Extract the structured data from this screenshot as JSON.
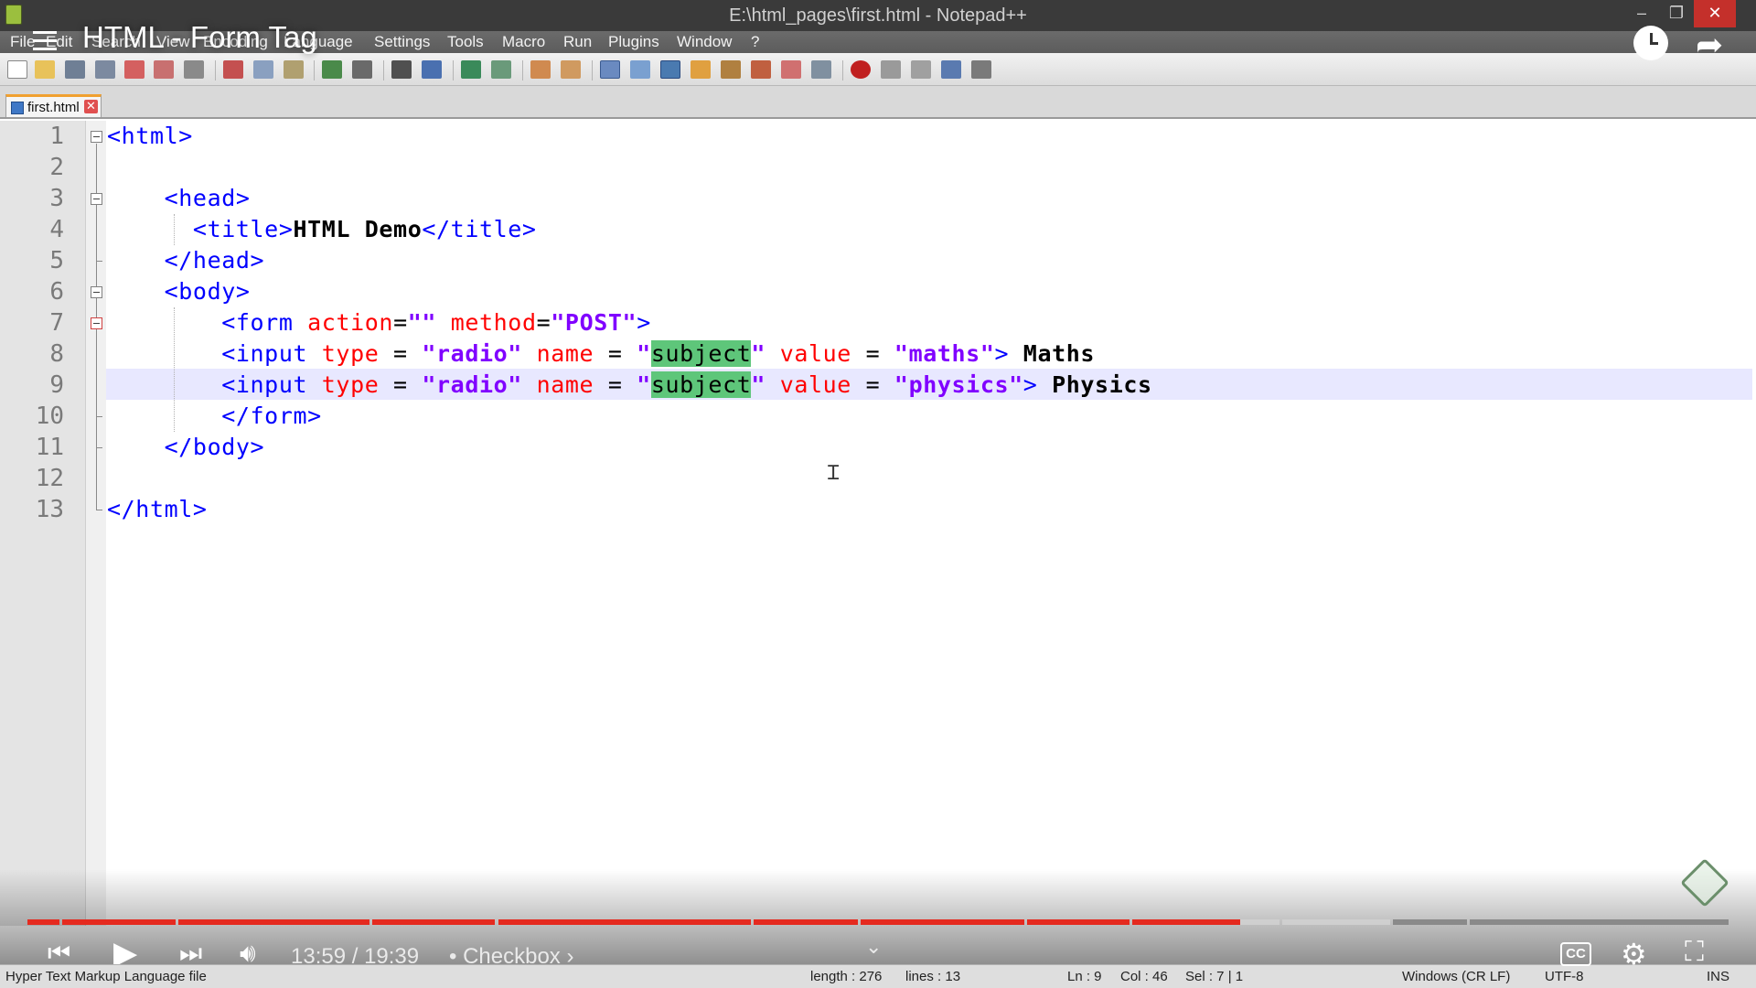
{
  "window": {
    "title": "E:\\html_pages\\first.html - Notepad++",
    "controls": {
      "minimize": "–",
      "maximize": "❐",
      "close": "✕"
    }
  },
  "menu": [
    "File",
    "Edit",
    "Search",
    "View",
    "Encoding",
    "Language",
    "Settings",
    "Tools",
    "Macro",
    "Run",
    "Plugins",
    "Window",
    "?"
  ],
  "tab": {
    "label": "first.html",
    "close": "✕"
  },
  "editor": {
    "line_numbers": [
      "1",
      "2",
      "3",
      "4",
      "5",
      "6",
      "7",
      "8",
      "9",
      "10",
      "11",
      "12",
      "13"
    ],
    "current_line": 9,
    "lines": [
      [
        {
          "c": "tag",
          "t": "<html>"
        }
      ],
      [],
      [
        {
          "c": "p",
          "t": "    "
        },
        {
          "c": "tag",
          "t": "<head>"
        }
      ],
      [
        {
          "c": "p",
          "t": "      "
        },
        {
          "c": "tag",
          "t": "<title>"
        },
        {
          "c": "txt",
          "t": "HTML Demo"
        },
        {
          "c": "tag",
          "t": "</title>"
        }
      ],
      [
        {
          "c": "p",
          "t": "    "
        },
        {
          "c": "tag",
          "t": "</head>"
        }
      ],
      [
        {
          "c": "p",
          "t": "    "
        },
        {
          "c": "tag",
          "t": "<body>"
        }
      ],
      [
        {
          "c": "p",
          "t": "        "
        },
        {
          "c": "tag",
          "t": "<form "
        },
        {
          "c": "attr",
          "t": "action"
        },
        {
          "c": "p",
          "t": "="
        },
        {
          "c": "val",
          "t": "\"\""
        },
        {
          "c": "p",
          "t": " "
        },
        {
          "c": "attr",
          "t": "method"
        },
        {
          "c": "p",
          "t": "="
        },
        {
          "c": "val",
          "t": "\"POST\""
        },
        {
          "c": "tag",
          "t": ">"
        }
      ],
      [
        {
          "c": "p",
          "t": "        "
        },
        {
          "c": "tag",
          "t": "<input "
        },
        {
          "c": "attr",
          "t": "type"
        },
        {
          "c": "p",
          "t": " = "
        },
        {
          "c": "val",
          "t": "\"radio\""
        },
        {
          "c": "p",
          "t": " "
        },
        {
          "c": "attr",
          "t": "name"
        },
        {
          "c": "p",
          "t": " = "
        },
        {
          "c": "val",
          "t": "\""
        },
        {
          "c": "hl",
          "t": "subject"
        },
        {
          "c": "val",
          "t": "\""
        },
        {
          "c": "p",
          "t": " "
        },
        {
          "c": "attr",
          "t": "value"
        },
        {
          "c": "p",
          "t": " = "
        },
        {
          "c": "val",
          "t": "\"maths\""
        },
        {
          "c": "tag",
          "t": ">"
        },
        {
          "c": "txt",
          "t": " Maths"
        }
      ],
      [
        {
          "c": "p",
          "t": "        "
        },
        {
          "c": "tag",
          "t": "<input "
        },
        {
          "c": "attr",
          "t": "type"
        },
        {
          "c": "p",
          "t": " = "
        },
        {
          "c": "val",
          "t": "\"radio\""
        },
        {
          "c": "p",
          "t": " "
        },
        {
          "c": "attr",
          "t": "name"
        },
        {
          "c": "p",
          "t": " = "
        },
        {
          "c": "val",
          "t": "\""
        },
        {
          "c": "hl",
          "t": "subject"
        },
        {
          "c": "val",
          "t": "\""
        },
        {
          "c": "p",
          "t": " "
        },
        {
          "c": "attr",
          "t": "value"
        },
        {
          "c": "p",
          "t": " = "
        },
        {
          "c": "val",
          "t": "\"physics\""
        },
        {
          "c": "tag",
          "t": ">"
        },
        {
          "c": "txt",
          "t": " Physics"
        }
      ],
      [
        {
          "c": "p",
          "t": "        "
        },
        {
          "c": "tag",
          "t": "</form>"
        }
      ],
      [
        {
          "c": "p",
          "t": "    "
        },
        {
          "c": "tag",
          "t": "</body>"
        }
      ],
      [],
      [
        {
          "c": "tag",
          "t": "</html>"
        }
      ]
    ]
  },
  "statusbar": {
    "file_type": "Hyper Text Markup Language file",
    "length": "length : 276",
    "lines": "lines : 13",
    "ln": "Ln : 9",
    "col": "Col : 46",
    "sel": "Sel : 7 | 1",
    "eol": "Windows (CR LF)",
    "encoding": "UTF-8",
    "mode": "INS"
  },
  "player": {
    "video_title": "HTML - Form Tag",
    "time": "13:59 / 19:39",
    "chapter": "• Checkbox ›",
    "progress_fraction": 0.7125,
    "colors": {
      "played": "#e52a1f",
      "buffered": "#cfcfcf",
      "remaining": "#8a8a8a"
    }
  }
}
